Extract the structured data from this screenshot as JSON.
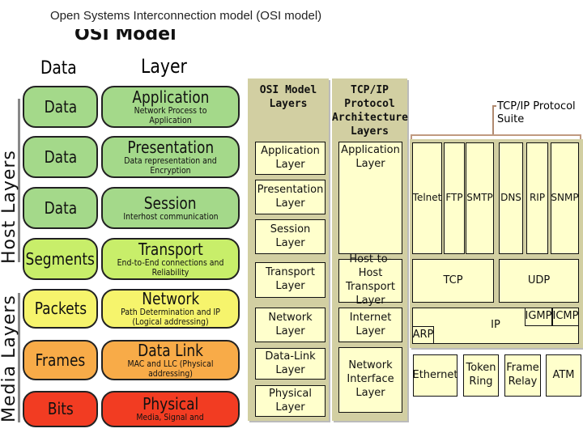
{
  "title": "Open Systems Interconnection model (OSI model)",
  "left": {
    "heading": "OSI Model",
    "data_header": "Data",
    "layer_header": "Layer",
    "host_label": "Host Layers",
    "media_label": "Media Layers",
    "rows": [
      {
        "data": "Data",
        "layer": "Application",
        "desc": "Network Process to Application",
        "color": "#a4d98a"
      },
      {
        "data": "Data",
        "layer": "Presentation",
        "desc": "Data representation and Encryption",
        "color": "#a4d98a"
      },
      {
        "data": "Data",
        "layer": "Session",
        "desc": "Interhost communication",
        "color": "#a4d98a"
      },
      {
        "data": "Segments",
        "layer": "Transport",
        "desc": "End-to-End connections and Reliability",
        "color": "#c8ee6a"
      },
      {
        "data": "Packets",
        "layer": "Network",
        "desc": "Path Determination and IP (Logical addressing)",
        "color": "#f6f46c"
      },
      {
        "data": "Frames",
        "layer": "Data Link",
        "desc": "MAC and LLC (Physical addressing)",
        "color": "#f8ab48"
      },
      {
        "data": "Bits",
        "layer": "Physical",
        "desc": "Media, Signal and",
        "color": "#f23c22"
      }
    ]
  },
  "right": {
    "osi_header": "OSI Model\nLayers",
    "osi": [
      "Application\nLayer",
      "Presentation\nLayer",
      "Session\nLayer",
      "Transport\nLayer",
      "Network\nLayer",
      "Data-Link\nLayer",
      "Physical\nLayer"
    ],
    "tcp_header": "TCP/IP\nProtocol\nArchitecture\nLayers",
    "tcp": [
      "Application\nLayer",
      "Host-to-Host\nTransport\nLayer",
      "Internet\nLayer",
      "Network\nInterface\nLayer"
    ],
    "suite_label": "TCP/IP Protocol\nSuite",
    "apps": [
      "Telnet",
      "FTP",
      "SMTP",
      "DNS",
      "RIP",
      "SNMP"
    ],
    "tcp_proto": "TCP",
    "udp": "UDP",
    "ip": "IP",
    "igmp": "IGMP",
    "icmp": "ICMP",
    "arp": "ARP",
    "links": [
      "Ethernet",
      "Token\nRing",
      "Frame\nRelay",
      "ATM"
    ]
  }
}
